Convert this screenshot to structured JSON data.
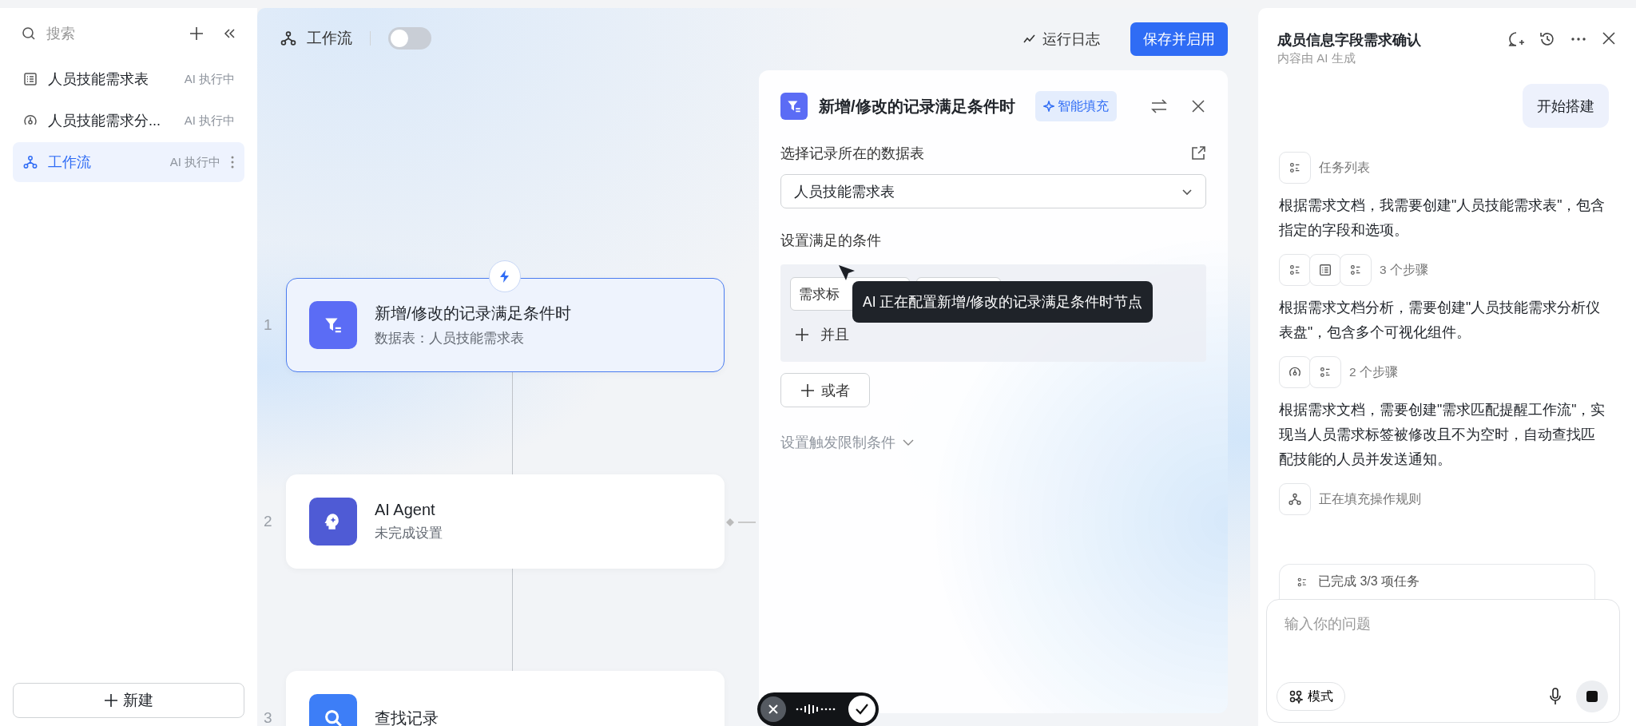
{
  "sidebar": {
    "search_placeholder": "搜索",
    "items": [
      {
        "label": "人员技能需求表",
        "status": "AI 执行中",
        "kind": "table",
        "selected": false
      },
      {
        "label": "人员技能需求分...",
        "status": "AI 执行中",
        "kind": "dashboard",
        "selected": false
      },
      {
        "label": "工作流",
        "status": "AI 执行中",
        "kind": "workflow",
        "selected": true
      }
    ],
    "new_button": "新建"
  },
  "canvas": {
    "title": "工作流",
    "toggle_on": false,
    "run_log": "运行日志",
    "save_button": "保存并启用",
    "nodes": [
      {
        "index": "1",
        "title": "新增/修改的记录满足条件时",
        "subtitle": "数据表：人员技能需求表",
        "kind": "filter",
        "selected": true
      },
      {
        "index": "2",
        "title": "AI Agent",
        "subtitle": "未完成设置",
        "kind": "agent",
        "selected": false
      },
      {
        "index": "3",
        "title": "查找记录",
        "kind": "search",
        "selected": false
      }
    ]
  },
  "config_panel": {
    "title": "新增/修改的记录满足条件时",
    "smart_fill": "智能填充",
    "table_label": "选择记录所在的数据表",
    "table_value": "人员技能需求表",
    "conditions_label": "设置满足的条件",
    "condition_chips": [
      "需求标"
    ],
    "and_button": "并且",
    "or_button": "或者",
    "limit_toggle": "设置触发限制条件",
    "tooltip": "AI 正在配置新增/修改的记录满足条件时节点"
  },
  "chat": {
    "title": "成员信息字段需求确认",
    "subtitle": "内容由 AI 生成",
    "messages": [
      {
        "kind": "user",
        "text": "开始搭建"
      },
      {
        "kind": "tool",
        "icons": [
          {
            "kind": "list"
          }
        ],
        "label": "任务列表"
      },
      {
        "kind": "text",
        "text": "根据需求文档，我需要创建\"人员技能需求表\"，包含指定的字段和选项。"
      },
      {
        "kind": "tool",
        "icons": [
          {
            "kind": "list"
          },
          {
            "kind": "table"
          },
          {
            "kind": "list"
          }
        ],
        "label": "3 个步骤"
      },
      {
        "kind": "text",
        "text": "根据需求文档分析，需要创建\"人员技能需求分析仪表盘\"，包含多个可视化组件。"
      },
      {
        "kind": "tool",
        "icons": [
          {
            "kind": "dashboard"
          },
          {
            "kind": "list"
          }
        ],
        "label": "2 个步骤"
      },
      {
        "kind": "text",
        "text": "根据需求文档，需要创建\"需求匹配提醒工作流\"，实现当人员需求标签被修改且不为空时，自动查找匹配技能的人员并发送通知。"
      },
      {
        "kind": "tool",
        "icons": [
          {
            "kind": "workflow"
          }
        ],
        "label": "正在填充操作规则"
      }
    ],
    "task_summary": "已完成 3/3 项任务",
    "input_placeholder": "输入你的问题",
    "mode_button": "模式"
  }
}
